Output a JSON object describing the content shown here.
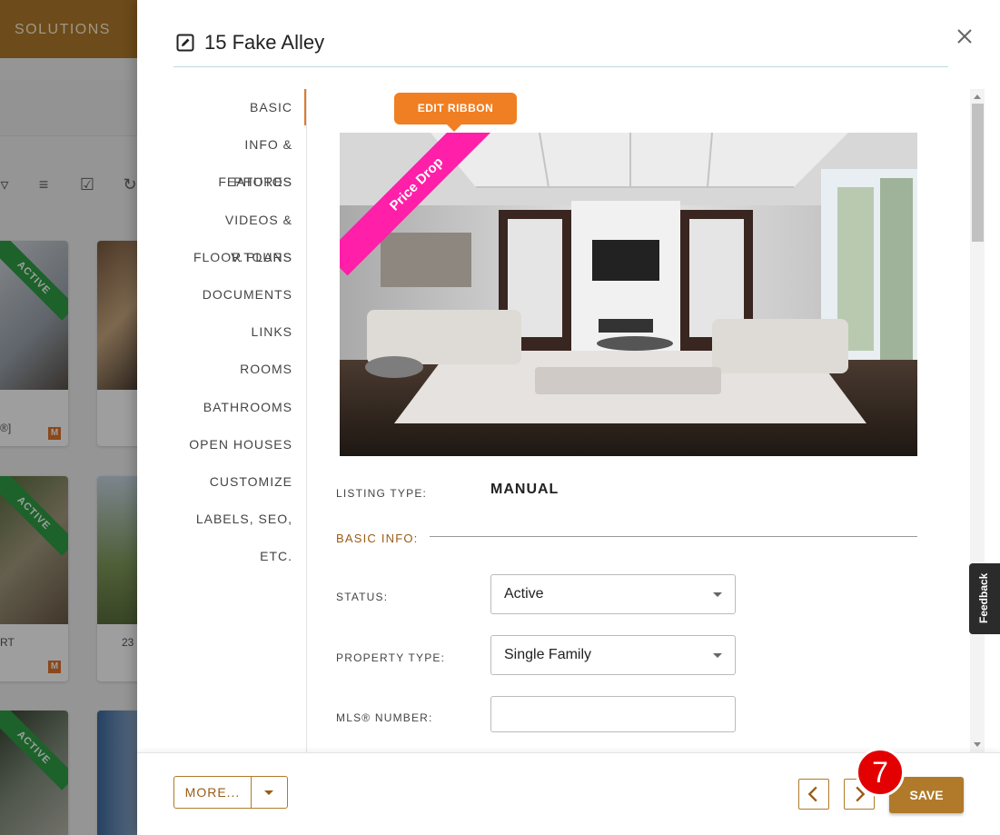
{
  "background": {
    "topbar_label": "SOLUTIONS",
    "cards": [
      {
        "ribbon": "ACTIVE",
        "addr": "®]",
        "badge": "M"
      },
      {
        "ribbon": "ACTIVE",
        "addr": "RT",
        "badge": "M"
      },
      {
        "ribbon": "",
        "addr": "23",
        "badge": ""
      },
      {
        "ribbon": "ACTIVE",
        "addr": "",
        "badge": ""
      }
    ]
  },
  "modal": {
    "title": "15 Fake Alley",
    "nav": [
      "BASIC",
      "INFO & FEATURES",
      "PHOTOS",
      "VIDEOS & V.TOURS",
      "FLOOR PLANS",
      "DOCUMENTS",
      "LINKS",
      "ROOMS",
      "BATHROOMS",
      "OPEN HOUSES",
      "CUSTOMIZE",
      "LABELS, SEO, ETC."
    ],
    "edit_ribbon_label": "EDIT RIBBON",
    "photo_ribbon": "Price Drop",
    "listing_type_label": "LISTING TYPE:",
    "listing_type_value": "MANUAL",
    "basic_info_label": "BASIC INFO:",
    "status_label": "STATUS:",
    "status_value": "Active",
    "property_type_label": "PROPERTY TYPE:",
    "property_type_value": "Single Family",
    "mls_label": "MLS® NUMBER:",
    "mls_value": ""
  },
  "footer": {
    "more_label": "MORE...",
    "save_label": "SAVE",
    "step_number": "7"
  },
  "feedback_label": "Feedback",
  "colors": {
    "accent": "#b07a2a",
    "edit_ribbon": "#f07e22",
    "price_drop_ribbon": "#ff1fa8",
    "active_ribbon": "#2e9e45",
    "step_badge": "#e30000"
  }
}
